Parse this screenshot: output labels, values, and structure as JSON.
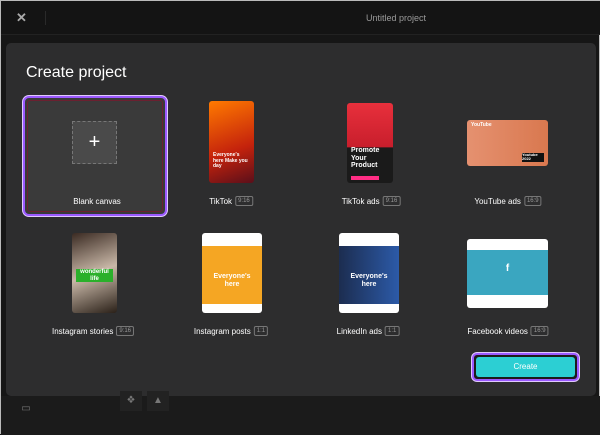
{
  "app": {
    "title": "Untitled project",
    "logo": "capcut-logo"
  },
  "dialog": {
    "title": "Create project",
    "blank": {
      "label": "Blank canvas",
      "icon": "plus-icon"
    },
    "templates": [
      {
        "label": "TikTok",
        "ratio": "9:16",
        "overlay": "Everyone's here Make you day"
      },
      {
        "label": "TikTok ads",
        "ratio": "9:16",
        "overlay": "Promote Your Product"
      },
      {
        "label": "YouTube ads",
        "ratio": "16:9",
        "overlay": "YouTube",
        "overlay2": "Youtube 2022"
      },
      {
        "label": "Instagram stories",
        "ratio": "9:16",
        "overlay": "wonderful life"
      },
      {
        "label": "Instagram posts",
        "ratio": "1:1",
        "overlay": "Everyone's here"
      },
      {
        "label": "LinkedIn ads",
        "ratio": "1:1",
        "overlay": "Everyone's here"
      },
      {
        "label": "Facebook videos",
        "ratio": "16:9",
        "overlay": "f"
      }
    ],
    "create_label": "Create",
    "accent": "#2ccfd3",
    "focus": "#9b59ff"
  },
  "bottom": {
    "icons": [
      "subtitle-icon",
      "dropbox-icon",
      "google-drive-icon"
    ]
  }
}
